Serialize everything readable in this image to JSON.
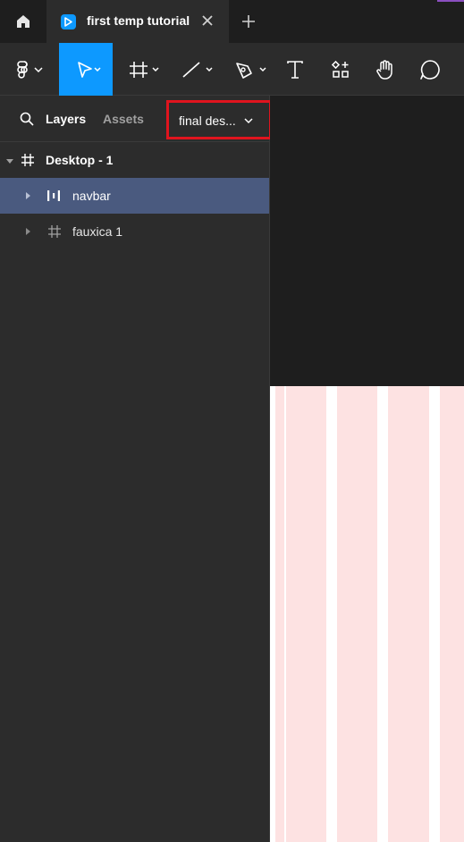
{
  "tabbar": {
    "tab_title": "first temp tutorial",
    "icons": [
      "home-icon",
      "file-icon",
      "close-icon",
      "plus-icon"
    ]
  },
  "toolbar": {
    "tools": [
      {
        "name": "main-menu",
        "icon": "figma-logo-icon",
        "active": false
      },
      {
        "name": "move-tool",
        "icon": "pointer-icon",
        "active": true
      },
      {
        "name": "frame-tool",
        "icon": "frame-icon",
        "active": false
      },
      {
        "name": "line-tool",
        "icon": "line-icon",
        "active": false
      },
      {
        "name": "pen-tool",
        "icon": "pen-icon",
        "active": false
      },
      {
        "name": "text-tool",
        "icon": "text-icon",
        "active": false
      },
      {
        "name": "resources-tool",
        "icon": "resources-icon",
        "active": false
      },
      {
        "name": "hand-tool",
        "icon": "hand-icon",
        "active": false
      },
      {
        "name": "comment-tool",
        "icon": "comment-icon",
        "active": false
      }
    ],
    "accent_color": "#0d99ff"
  },
  "panel": {
    "tabs": {
      "layers": "Layers",
      "assets": "Assets"
    },
    "page_selector": "final des...",
    "highlight_color": "#e0141e"
  },
  "layers": [
    {
      "label": "Desktop - 1",
      "icon": "frame-icon",
      "level": 0,
      "expanded": true,
      "selected": false
    },
    {
      "label": "navbar",
      "icon": "auto-layout-icon",
      "level": 1,
      "expanded": false,
      "selected": true
    },
    {
      "label": "fauxica 1",
      "icon": "frame-icon",
      "level": 1,
      "expanded": false,
      "selected": false
    }
  ],
  "colors": {
    "selected_row": "#4a5a7f",
    "layout_grid": "#fde2e2"
  }
}
